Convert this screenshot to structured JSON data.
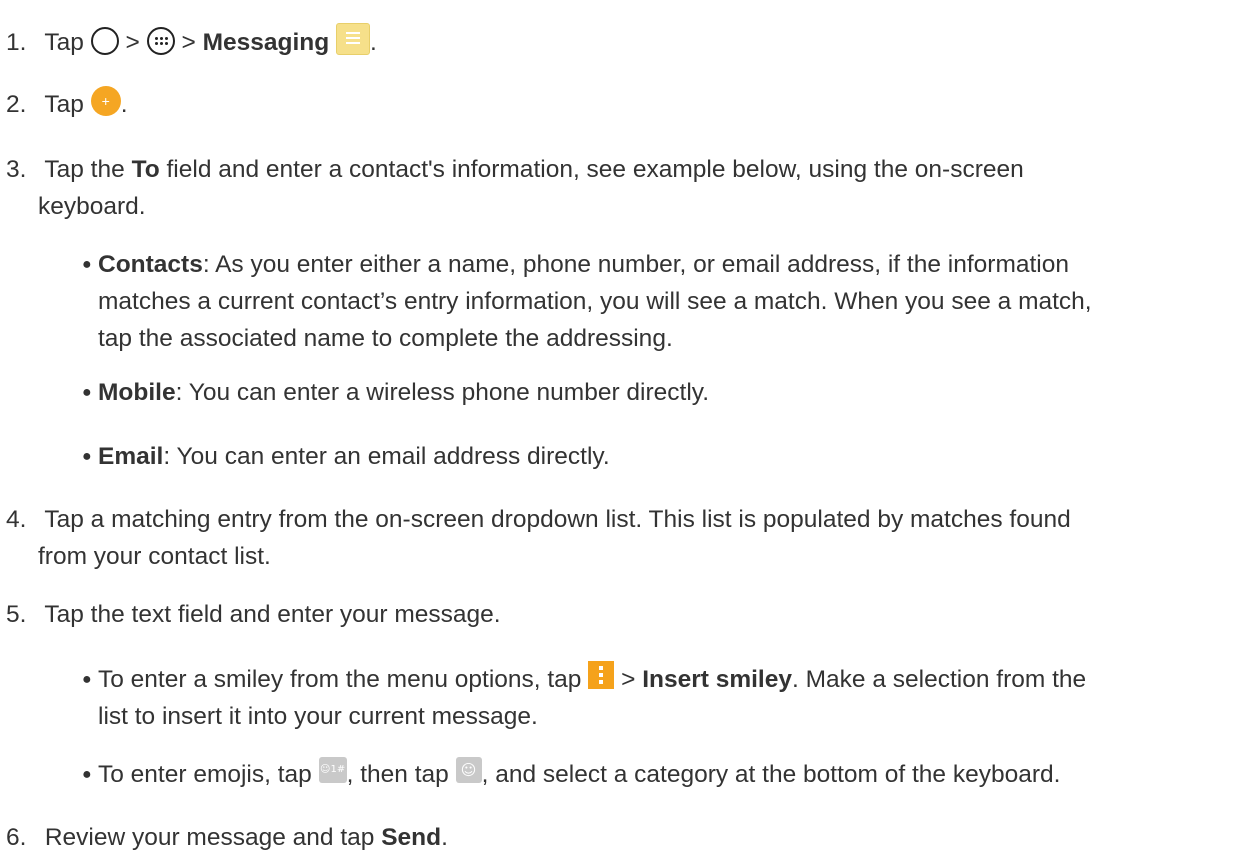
{
  "steps": [
    {
      "num": "1.",
      "pre": "Tap",
      "sep1": ">",
      "sep2": ">",
      "bold": "Messaging",
      "post": "."
    },
    {
      "num": "2.",
      "pre": "Tap",
      "post": "."
    },
    {
      "num": "3.",
      "pre": "Tap the",
      "bold": "To",
      "line1": "field and enter a contact's information, see example below, using the on-screen",
      "line2": "keyboard."
    },
    {
      "num": "4.",
      "line1": "Tap a matching entry from the on-screen dropdown list. This list is populated by matches found",
      "line2": "from your contact list."
    },
    {
      "num": "5.",
      "text": "Tap the text field and enter your message."
    },
    {
      "num": "6.",
      "pre": "Review your message and tap",
      "bold": "Send",
      "post": "."
    }
  ],
  "bullets": {
    "contacts": {
      "bold": "Contacts",
      "line1": ": As you enter either a name, phone number, or email address, if the information",
      "line2": "matches a current contact’s entry information, you will see a match. When you see a match,",
      "line3": "tap the associated name to complete the addressing."
    },
    "mobile": {
      "bold": "Mobile",
      "text": ": You can enter a wireless phone number directly."
    },
    "email": {
      "bold": "Email",
      "text": ": You can enter an email address directly."
    },
    "smiley": {
      "pre": "To enter a smiley from the menu options, tap",
      "sep": ">",
      "bold": "Insert smiley",
      "line1": ". Make a selection from the",
      "line2": "list to insert it into your current message."
    },
    "emoji": {
      "pre": "To enter emojis, tap",
      "mid": ", then tap",
      "post": ", and select a category at the bottom of the keyboard."
    }
  },
  "icons": {
    "home": "home-circle-icon",
    "apps": "apps-grid-icon",
    "messaging": "messaging-app-icon",
    "compose": "compose-plus-icon",
    "menu": "menu-dots-icon",
    "symbols": "symbols-key-icon",
    "smiley": "smiley-key-icon",
    "symbols_label": "☺1#",
    "smiley_label": "☺",
    "compose_label": "+"
  }
}
